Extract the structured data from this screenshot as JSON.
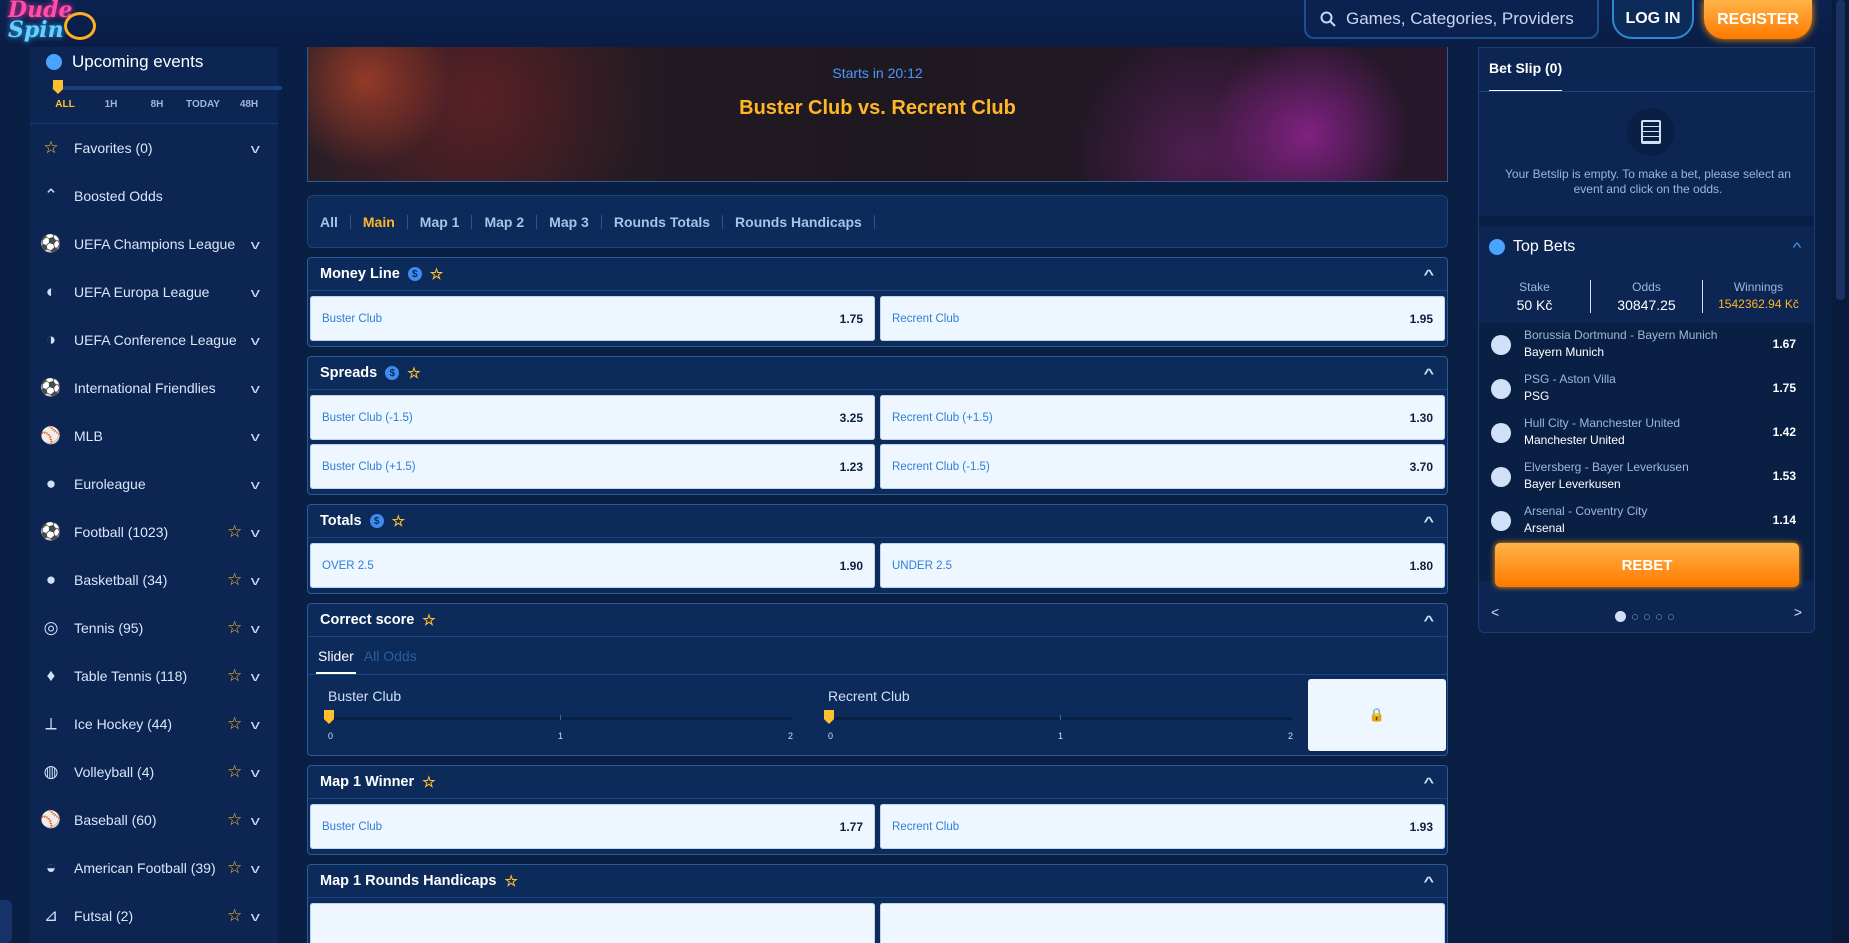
{
  "header": {
    "logo_line1": "Dude",
    "logo_line2": "Spin",
    "search_placeholder": "Games, Categories, Providers",
    "login_label": "LOG IN",
    "register_label": "REGISTER"
  },
  "sidebar": {
    "upcoming_title": "Upcoming events",
    "ranges": [
      "ALL",
      "1H",
      "8H",
      "TODAY",
      "48H"
    ],
    "items": [
      {
        "label": "Favorites (0)",
        "icon": "star-icon",
        "star": false,
        "chevron": true
      },
      {
        "label": "Boosted Odds",
        "icon": "boost-icon",
        "star": false,
        "chevron": false
      },
      {
        "label": "UEFA Champions League",
        "icon": "champions-league-icon",
        "star": false,
        "chevron": true
      },
      {
        "label": "UEFA Europa League",
        "icon": "europa-league-icon",
        "star": false,
        "chevron": true
      },
      {
        "label": "UEFA Conference League",
        "icon": "conference-league-icon",
        "star": false,
        "chevron": true
      },
      {
        "label": "International Friendlies",
        "icon": "football-icon",
        "star": false,
        "chevron": true
      },
      {
        "label": "MLB",
        "icon": "mlb-icon",
        "star": false,
        "chevron": true
      },
      {
        "label": "Euroleague",
        "icon": "basketball-icon",
        "star": false,
        "chevron": true
      },
      {
        "label": "Football (1023)",
        "icon": "football-icon",
        "star": true,
        "chevron": true
      },
      {
        "label": "Basketball (34)",
        "icon": "basketball-icon",
        "star": true,
        "chevron": true
      },
      {
        "label": "Tennis (95)",
        "icon": "tennis-icon",
        "star": true,
        "chevron": true
      },
      {
        "label": "Table Tennis (118)",
        "icon": "table-tennis-icon",
        "star": true,
        "chevron": true
      },
      {
        "label": "Ice Hockey (44)",
        "icon": "ice-hockey-icon",
        "star": true,
        "chevron": true
      },
      {
        "label": "Volleyball (4)",
        "icon": "volleyball-icon",
        "star": true,
        "chevron": true
      },
      {
        "label": "Baseball (60)",
        "icon": "baseball-icon",
        "star": true,
        "chevron": true
      },
      {
        "label": "American Football (39)",
        "icon": "american-football-icon",
        "star": true,
        "chevron": true
      },
      {
        "label": "Futsal (2)",
        "icon": "futsal-icon",
        "star": true,
        "chevron": true
      }
    ]
  },
  "event": {
    "starts": "Starts in 20:12",
    "match": "Buster Club vs. Recrent Club"
  },
  "tabs": [
    "All",
    "Main",
    "Map 1",
    "Map 2",
    "Map 3",
    "Rounds Totals",
    "Rounds Handicaps"
  ],
  "active_tab": "Main",
  "markets": {
    "money_line": {
      "title": "Money Line",
      "odds": [
        [
          "Buster Club",
          "1.75"
        ],
        [
          "Recrent Club",
          "1.95"
        ]
      ]
    },
    "spreads": {
      "title": "Spreads",
      "rows": [
        [
          [
            "Buster Club (-1.5)",
            "3.25"
          ],
          [
            "Recrent Club (+1.5)",
            "1.30"
          ]
        ],
        [
          [
            "Buster Club (+1.5)",
            "1.23"
          ],
          [
            "Recrent Club (-1.5)",
            "3.70"
          ]
        ]
      ]
    },
    "totals": {
      "title": "Totals",
      "odds": [
        [
          "OVER 2.5",
          "1.90"
        ],
        [
          "UNDER 2.5",
          "1.80"
        ]
      ]
    },
    "correct_score": {
      "title": "Correct score",
      "tab_slider": "Slider",
      "tab_all": "All Odds",
      "team1": "Buster Club",
      "team2": "Recrent Club",
      "ticks": [
        "0",
        "1",
        "2"
      ]
    },
    "map1_winner": {
      "title": "Map 1 Winner",
      "odds": [
        [
          "Buster Club",
          "1.77"
        ],
        [
          "Recrent Club",
          "1.93"
        ]
      ]
    },
    "map1_rounds": {
      "title": "Map 1 Rounds Handicaps"
    }
  },
  "betslip": {
    "tab": "Bet Slip (0)",
    "empty_text": "Your Betslip is empty. To make a bet, please select an event and click on the odds.",
    "top_bets_title": "Top Bets",
    "stake_label": "Stake",
    "stake_value": "50 Kč",
    "odds_label": "Odds",
    "odds_value": "30847.25",
    "winnings_label": "Winnings",
    "winnings_value": "1542362.94 Kč",
    "bets": [
      {
        "event": "Borussia Dortmund - Bayern Munich",
        "pick": "Bayern Munich",
        "odd": "1.67"
      },
      {
        "event": "PSG - Aston Villa",
        "pick": "PSG",
        "odd": "1.75"
      },
      {
        "event": "Hull City - Manchester United",
        "pick": "Manchester United",
        "odd": "1.42"
      },
      {
        "event": "Elversberg - Bayer Leverkusen",
        "pick": "Bayer Leverkusen",
        "odd": "1.53"
      },
      {
        "event": "Arsenal - Coventry City",
        "pick": "Arsenal",
        "odd": "1.14"
      }
    ],
    "rebet_label": "REBET"
  }
}
